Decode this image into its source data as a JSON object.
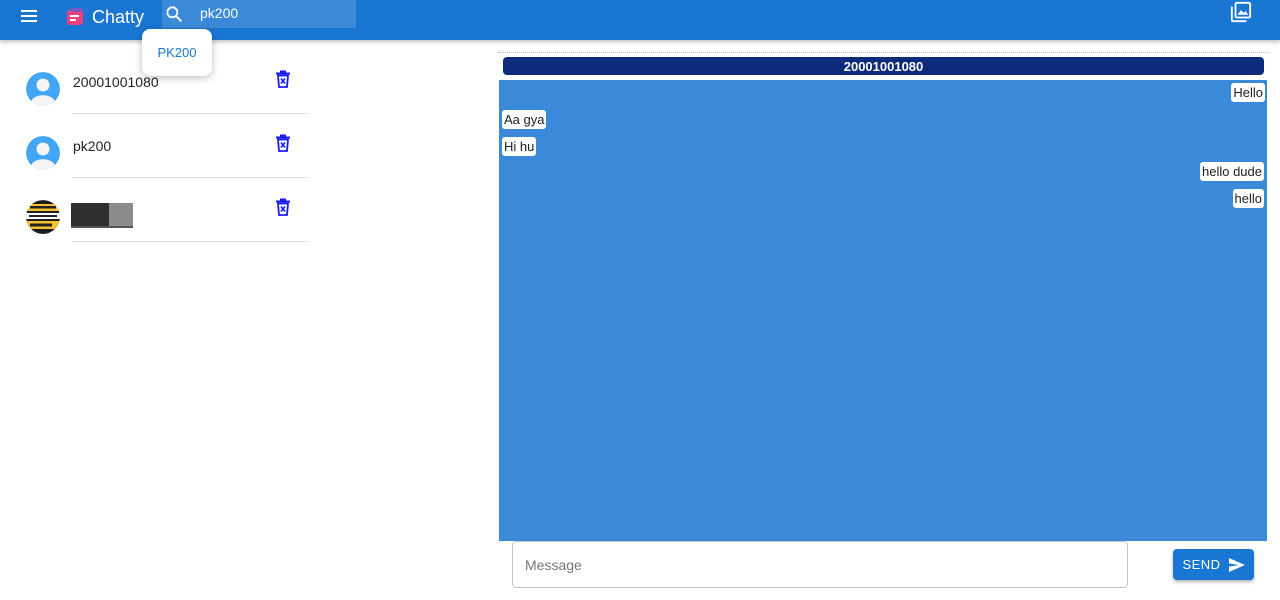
{
  "app": {
    "name": "Chatty"
  },
  "search": {
    "value": "pk200",
    "suggestions": [
      "PK200"
    ]
  },
  "contacts": [
    {
      "name": "20001001080"
    },
    {
      "name": "pk200"
    },
    {
      "name": ""
    }
  ],
  "chat": {
    "title": "20001001080",
    "messages": [
      {
        "text": "Hello",
        "side": "right"
      },
      {
        "text": "Aa gya",
        "side": "left"
      },
      {
        "text": "Hi hu",
        "side": "left"
      },
      {
        "text": "hello dude",
        "side": "right"
      },
      {
        "text": "hello",
        "side": "right"
      }
    ],
    "composer_placeholder": "Message",
    "send_label": "SEND"
  },
  "icons": {
    "menu": "menu-icon",
    "search": "search-icon",
    "gallery": "photo-library-icon",
    "delete": "delete-forever-icon",
    "send": "send-icon"
  },
  "colors": {
    "app_bar": "#1976d2",
    "chat_background": "#3b89d9",
    "chat_header": "#0d2b7a",
    "delete_icon": "#1a1aff"
  }
}
